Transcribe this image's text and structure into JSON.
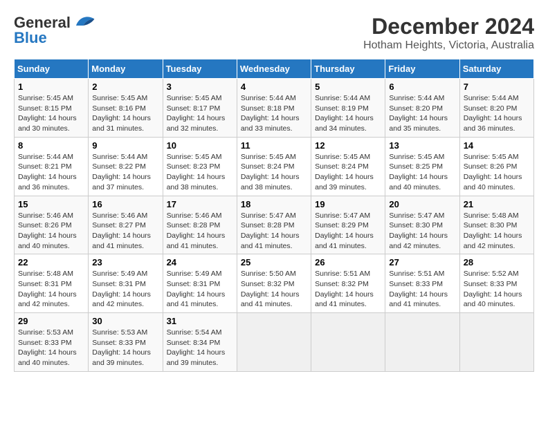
{
  "logo": {
    "text1": "General",
    "text2": "Blue"
  },
  "title": "December 2024",
  "subtitle": "Hotham Heights, Victoria, Australia",
  "weekdays": [
    "Sunday",
    "Monday",
    "Tuesday",
    "Wednesday",
    "Thursday",
    "Friday",
    "Saturday"
  ],
  "weeks": [
    [
      {
        "day": "1",
        "sunrise": "5:45 AM",
        "sunset": "8:15 PM",
        "daylight": "14 hours and 30 minutes."
      },
      {
        "day": "2",
        "sunrise": "5:45 AM",
        "sunset": "8:16 PM",
        "daylight": "14 hours and 31 minutes."
      },
      {
        "day": "3",
        "sunrise": "5:45 AM",
        "sunset": "8:17 PM",
        "daylight": "14 hours and 32 minutes."
      },
      {
        "day": "4",
        "sunrise": "5:44 AM",
        "sunset": "8:18 PM",
        "daylight": "14 hours and 33 minutes."
      },
      {
        "day": "5",
        "sunrise": "5:44 AM",
        "sunset": "8:19 PM",
        "daylight": "14 hours and 34 minutes."
      },
      {
        "day": "6",
        "sunrise": "5:44 AM",
        "sunset": "8:20 PM",
        "daylight": "14 hours and 35 minutes."
      },
      {
        "day": "7",
        "sunrise": "5:44 AM",
        "sunset": "8:20 PM",
        "daylight": "14 hours and 36 minutes."
      }
    ],
    [
      {
        "day": "8",
        "sunrise": "5:44 AM",
        "sunset": "8:21 PM",
        "daylight": "14 hours and 36 minutes."
      },
      {
        "day": "9",
        "sunrise": "5:44 AM",
        "sunset": "8:22 PM",
        "daylight": "14 hours and 37 minutes."
      },
      {
        "day": "10",
        "sunrise": "5:45 AM",
        "sunset": "8:23 PM",
        "daylight": "14 hours and 38 minutes."
      },
      {
        "day": "11",
        "sunrise": "5:45 AM",
        "sunset": "8:24 PM",
        "daylight": "14 hours and 38 minutes."
      },
      {
        "day": "12",
        "sunrise": "5:45 AM",
        "sunset": "8:24 PM",
        "daylight": "14 hours and 39 minutes."
      },
      {
        "day": "13",
        "sunrise": "5:45 AM",
        "sunset": "8:25 PM",
        "daylight": "14 hours and 40 minutes."
      },
      {
        "day": "14",
        "sunrise": "5:45 AM",
        "sunset": "8:26 PM",
        "daylight": "14 hours and 40 minutes."
      }
    ],
    [
      {
        "day": "15",
        "sunrise": "5:46 AM",
        "sunset": "8:26 PM",
        "daylight": "14 hours and 40 minutes."
      },
      {
        "day": "16",
        "sunrise": "5:46 AM",
        "sunset": "8:27 PM",
        "daylight": "14 hours and 41 minutes."
      },
      {
        "day": "17",
        "sunrise": "5:46 AM",
        "sunset": "8:28 PM",
        "daylight": "14 hours and 41 minutes."
      },
      {
        "day": "18",
        "sunrise": "5:47 AM",
        "sunset": "8:28 PM",
        "daylight": "14 hours and 41 minutes."
      },
      {
        "day": "19",
        "sunrise": "5:47 AM",
        "sunset": "8:29 PM",
        "daylight": "14 hours and 41 minutes."
      },
      {
        "day": "20",
        "sunrise": "5:47 AM",
        "sunset": "8:30 PM",
        "daylight": "14 hours and 42 minutes."
      },
      {
        "day": "21",
        "sunrise": "5:48 AM",
        "sunset": "8:30 PM",
        "daylight": "14 hours and 42 minutes."
      }
    ],
    [
      {
        "day": "22",
        "sunrise": "5:48 AM",
        "sunset": "8:31 PM",
        "daylight": "14 hours and 42 minutes."
      },
      {
        "day": "23",
        "sunrise": "5:49 AM",
        "sunset": "8:31 PM",
        "daylight": "14 hours and 42 minutes."
      },
      {
        "day": "24",
        "sunrise": "5:49 AM",
        "sunset": "8:31 PM",
        "daylight": "14 hours and 41 minutes."
      },
      {
        "day": "25",
        "sunrise": "5:50 AM",
        "sunset": "8:32 PM",
        "daylight": "14 hours and 41 minutes."
      },
      {
        "day": "26",
        "sunrise": "5:51 AM",
        "sunset": "8:32 PM",
        "daylight": "14 hours and 41 minutes."
      },
      {
        "day": "27",
        "sunrise": "5:51 AM",
        "sunset": "8:33 PM",
        "daylight": "14 hours and 41 minutes."
      },
      {
        "day": "28",
        "sunrise": "5:52 AM",
        "sunset": "8:33 PM",
        "daylight": "14 hours and 40 minutes."
      }
    ],
    [
      {
        "day": "29",
        "sunrise": "5:53 AM",
        "sunset": "8:33 PM",
        "daylight": "14 hours and 40 minutes."
      },
      {
        "day": "30",
        "sunrise": "5:53 AM",
        "sunset": "8:33 PM",
        "daylight": "14 hours and 39 minutes."
      },
      {
        "day": "31",
        "sunrise": "5:54 AM",
        "sunset": "8:34 PM",
        "daylight": "14 hours and 39 minutes."
      },
      null,
      null,
      null,
      null
    ]
  ]
}
